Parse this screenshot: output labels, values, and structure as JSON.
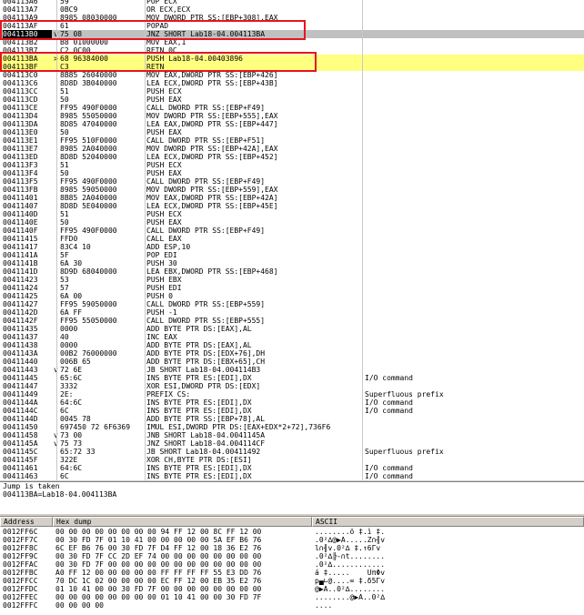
{
  "disasm_rows": [
    {
      "addr": "004113A6",
      "arrow": "",
      "hex": "59",
      "instr": "POP ECX",
      "comment": ""
    },
    {
      "addr": "004113A7",
      "arrow": "",
      "hex": "0BC9",
      "instr": "OR ECX,ECX",
      "comment": ""
    },
    {
      "addr": "004113A9",
      "arrow": "",
      "hex": "8985 08030000",
      "instr": "MOV DWORD PTR SS:[EBP+308],EAX",
      "comment": ""
    },
    {
      "addr": "004113AF",
      "arrow": "",
      "hex": "61",
      "instr": "POPAD",
      "comment": ""
    },
    {
      "addr": "004113B0",
      "arrow": "v",
      "hex": "75 08",
      "instr": "JNZ SHORT Lab18-04.004113BA",
      "comment": ""
    },
    {
      "addr": "004113B2",
      "arrow": "",
      "hex": "B8 01000000",
      "instr": "MOV EAX,1",
      "comment": ""
    },
    {
      "addr": "004113B7",
      "arrow": "",
      "hex": "C2 0C00",
      "instr": "RETN 0C",
      "comment": ""
    },
    {
      "addr": "004113BA",
      "arrow": ">",
      "hex": "68 96384000",
      "instr": "PUSH Lab18-04.00403896",
      "comment": ""
    },
    {
      "addr": "004113BF",
      "arrow": "",
      "hex": "C3",
      "instr": "RETN",
      "comment": ""
    },
    {
      "addr": "004113C0",
      "arrow": "",
      "hex": "8B85 26040000",
      "instr": "MOV EAX,DWORD PTR SS:[EBP+426]",
      "comment": ""
    },
    {
      "addr": "004113C6",
      "arrow": "",
      "hex": "8D8D 3B040000",
      "instr": "LEA ECX,DWORD PTR SS:[EBP+43B]",
      "comment": ""
    },
    {
      "addr": "004113CC",
      "arrow": "",
      "hex": "51",
      "instr": "PUSH ECX",
      "comment": ""
    },
    {
      "addr": "004113CD",
      "arrow": "",
      "hex": "50",
      "instr": "PUSH EAX",
      "comment": ""
    },
    {
      "addr": "004113CE",
      "arrow": "",
      "hex": "FF95 490F0000",
      "instr": "CALL DWORD PTR SS:[EBP+F49]",
      "comment": ""
    },
    {
      "addr": "004113D4",
      "arrow": "",
      "hex": "8985 55050000",
      "instr": "MOV DWORD PTR SS:[EBP+555],EAX",
      "comment": ""
    },
    {
      "addr": "004113DA",
      "arrow": "",
      "hex": "8D85 47040000",
      "instr": "LEA EAX,DWORD PTR SS:[EBP+447]",
      "comment": ""
    },
    {
      "addr": "004113E0",
      "arrow": "",
      "hex": "50",
      "instr": "PUSH EAX",
      "comment": ""
    },
    {
      "addr": "004113E1",
      "arrow": "",
      "hex": "FF95 510F0000",
      "instr": "CALL DWORD PTR SS:[EBP+F51]",
      "comment": ""
    },
    {
      "addr": "004113E7",
      "arrow": "",
      "hex": "8985 2A040000",
      "instr": "MOV DWORD PTR SS:[EBP+42A],EAX",
      "comment": ""
    },
    {
      "addr": "004113ED",
      "arrow": "",
      "hex": "8D8D 52040000",
      "instr": "LEA ECX,DWORD PTR SS:[EBP+452]",
      "comment": ""
    },
    {
      "addr": "004113F3",
      "arrow": "",
      "hex": "51",
      "instr": "PUSH ECX",
      "comment": ""
    },
    {
      "addr": "004113F4",
      "arrow": "",
      "hex": "50",
      "instr": "PUSH EAX",
      "comment": ""
    },
    {
      "addr": "004113F5",
      "arrow": "",
      "hex": "FF95 490F0000",
      "instr": "CALL DWORD PTR SS:[EBP+F49]",
      "comment": ""
    },
    {
      "addr": "004113FB",
      "arrow": "",
      "hex": "8985 59050000",
      "instr": "MOV DWORD PTR SS:[EBP+559],EAX",
      "comment": ""
    },
    {
      "addr": "00411401",
      "arrow": "",
      "hex": "8B85 2A040000",
      "instr": "MOV EAX,DWORD PTR SS:[EBP+42A]",
      "comment": ""
    },
    {
      "addr": "00411407",
      "arrow": "",
      "hex": "8D8D 5E040000",
      "instr": "LEA ECX,DWORD PTR SS:[EBP+45E]",
      "comment": ""
    },
    {
      "addr": "0041140D",
      "arrow": "",
      "hex": "51",
      "instr": "PUSH ECX",
      "comment": ""
    },
    {
      "addr": "0041140E",
      "arrow": "",
      "hex": "50",
      "instr": "PUSH EAX",
      "comment": ""
    },
    {
      "addr": "0041140F",
      "arrow": "",
      "hex": "FF95 490F0000",
      "instr": "CALL DWORD PTR SS:[EBP+F49]",
      "comment": ""
    },
    {
      "addr": "00411415",
      "arrow": "",
      "hex": "FFD0",
      "instr": "CALL EAX",
      "comment": ""
    },
    {
      "addr": "00411417",
      "arrow": "",
      "hex": "83C4 10",
      "instr": "ADD ESP,10",
      "comment": ""
    },
    {
      "addr": "0041141A",
      "arrow": "",
      "hex": "5F",
      "instr": "POP EDI",
      "comment": ""
    },
    {
      "addr": "0041141B",
      "arrow": "",
      "hex": "6A 30",
      "instr": "PUSH 30",
      "comment": ""
    },
    {
      "addr": "0041141D",
      "arrow": "",
      "hex": "8D9D 68040000",
      "instr": "LEA EBX,DWORD PTR SS:[EBP+468]",
      "comment": ""
    },
    {
      "addr": "00411423",
      "arrow": "",
      "hex": "53",
      "instr": "PUSH EBX",
      "comment": ""
    },
    {
      "addr": "00411424",
      "arrow": "",
      "hex": "57",
      "instr": "PUSH EDI",
      "comment": ""
    },
    {
      "addr": "00411425",
      "arrow": "",
      "hex": "6A 00",
      "instr": "PUSH 0",
      "comment": ""
    },
    {
      "addr": "00411427",
      "arrow": "",
      "hex": "FF95 59050000",
      "instr": "CALL DWORD PTR SS:[EBP+559]",
      "comment": ""
    },
    {
      "addr": "0041142D",
      "arrow": "",
      "hex": "6A FF",
      "instr": "PUSH -1",
      "comment": ""
    },
    {
      "addr": "0041142F",
      "arrow": "",
      "hex": "FF95 55050000",
      "instr": "CALL DWORD PTR SS:[EBP+555]",
      "comment": ""
    },
    {
      "addr": "00411435",
      "arrow": "",
      "hex": "0000",
      "instr": "ADD BYTE PTR DS:[EAX],AL",
      "comment": ""
    },
    {
      "addr": "00411437",
      "arrow": "",
      "hex": "40",
      "instr": "INC EAX",
      "comment": ""
    },
    {
      "addr": "00411438",
      "arrow": "",
      "hex": "0000",
      "instr": "ADD BYTE PTR DS:[EAX],AL",
      "comment": ""
    },
    {
      "addr": "0041143A",
      "arrow": "",
      "hex": "00B2 76000000",
      "instr": "ADD BYTE PTR DS:[EDX+76],DH",
      "comment": ""
    },
    {
      "addr": "00411440",
      "arrow": "",
      "hex": "006B 65",
      "instr": "ADD BYTE PTR DS:[EBX+65],CH",
      "comment": ""
    },
    {
      "addr": "00411443",
      "arrow": "v",
      "hex": "72 6E",
      "instr": "JB SHORT Lab18-04.004114B3",
      "comment": ""
    },
    {
      "addr": "00411445",
      "arrow": "",
      "hex": "65:6C",
      "instr": "INS BYTE PTR ES:[EDI],DX",
      "comment": "I/O command"
    },
    {
      "addr": "00411447",
      "arrow": "",
      "hex": "3332",
      "instr": "XOR ESI,DWORD PTR DS:[EDX]",
      "comment": ""
    },
    {
      "addr": "00411449",
      "arrow": "",
      "hex": "2E:",
      "instr": "PREFIX CS:",
      "comment": "Superfluous prefix"
    },
    {
      "addr": "0041144A",
      "arrow": "",
      "hex": "64:6C",
      "instr": "INS BYTE PTR ES:[EDI],DX",
      "comment": "I/O command"
    },
    {
      "addr": "0041144C",
      "arrow": "",
      "hex": "6C",
      "instr": "INS BYTE PTR ES:[EDI],DX",
      "comment": "I/O command"
    },
    {
      "addr": "0041144D",
      "arrow": "",
      "hex": "0045 78",
      "instr": "ADD BYTE PTR SS:[EBP+78],AL",
      "comment": ""
    },
    {
      "addr": "00411450",
      "arrow": "",
      "hex": "697450 72 6F6369",
      "instr": "IMUL ESI,DWORD PTR DS:[EAX+EDX*2+72],736F6",
      "comment": ""
    },
    {
      "addr": "00411458",
      "arrow": "v",
      "hex": "73 00",
      "instr": "JNB SHORT Lab18-04.0041145A",
      "comment": ""
    },
    {
      "addr": "0041145A",
      "arrow": "v",
      "hex": "75 73",
      "instr": "JNZ SHORT Lab18-04.004114CF",
      "comment": ""
    },
    {
      "addr": "0041145C",
      "arrow": "",
      "hex": "65:72 33",
      "instr": "JB SHORT Lab18-04.00411492",
      "comment": "Superfluous prefix"
    },
    {
      "addr": "0041145F",
      "arrow": "",
      "hex": "322E",
      "instr": "XOR CH,BYTE PTR DS:[ESI]",
      "comment": ""
    },
    {
      "addr": "00411461",
      "arrow": "",
      "hex": "64:6C",
      "instr": "INS BYTE PTR ES:[EDI],DX",
      "comment": "I/O command"
    },
    {
      "addr": "00411463",
      "arrow": "",
      "hex": "6C",
      "instr": "INS BYTE PTR ES:[EDI],DX",
      "comment": "I/O command"
    }
  ],
  "info": {
    "line1": "Jump is taken",
    "line2": "004113BA=Lab18-04.004113BA"
  },
  "dump": {
    "headers": {
      "address": "Address",
      "hex": "Hex dump",
      "ascii": "ASCII"
    },
    "rows": [
      {
        "addr": "0012FF6C",
        "hex": "00 00 00 00 00 00 00 00 94 FF 12 00 8C FF 12 00",
        "ascii": "........ö ‡.ì ‡."
      },
      {
        "addr": "0012FF7C",
        "hex": "00 30 FD 7F 01 10 41 00 00 00 00 00 5A EF B6 76",
        "ascii": ".0²∆@▶A.....Z∩╢v"
      },
      {
        "addr": "0012FF8C",
        "hex": "6C EF B6 76 00 30 FD 7F D4 FF 12 00 18 36 E2 76",
        "ascii": "l∩╢v.0²∆ ‡.↑6Γv"
      },
      {
        "addr": "0012FF9C",
        "hex": "00 30 FD 7F CC 2D EF 74 00 00 00 00 00 00 00 00",
        "ascii": ".0²∆╠-∩t........"
      },
      {
        "addr": "0012FFAC",
        "hex": "00 30 FD 7F 00 00 00 00 00 00 00 00 00 00 00 00",
        "ascii": ".0²∆............"
      },
      {
        "addr": "0012FFBC",
        "hex": "A0 FF 12 00 00 00 00 00 FF FF FF FF 55 E3 DD 76",
        "ascii": "á ‡.....    UπΦv"
      },
      {
        "addr": "0012FFCC",
        "hex": "70 DC 1C 02 00 00 00 00 EC FF 12 00 EB 35 E2 76",
        "ascii": "p▄∟@....∞ ‡.δ5Γv"
      },
      {
        "addr": "0012FFDC",
        "hex": "01 10 41 00 00 30 FD 7F 00 00 00 00 00 00 00 00",
        "ascii": "@▶A..0²∆........"
      },
      {
        "addr": "0012FFEC",
        "hex": "00 00 00 00 00 00 00 00 01 10 41 00 00 30 FD 7F",
        "ascii": "........@▶A..0²∆"
      },
      {
        "addr": "0012FFFC",
        "hex": "00 00 00 00",
        "ascii": "...."
      }
    ]
  }
}
